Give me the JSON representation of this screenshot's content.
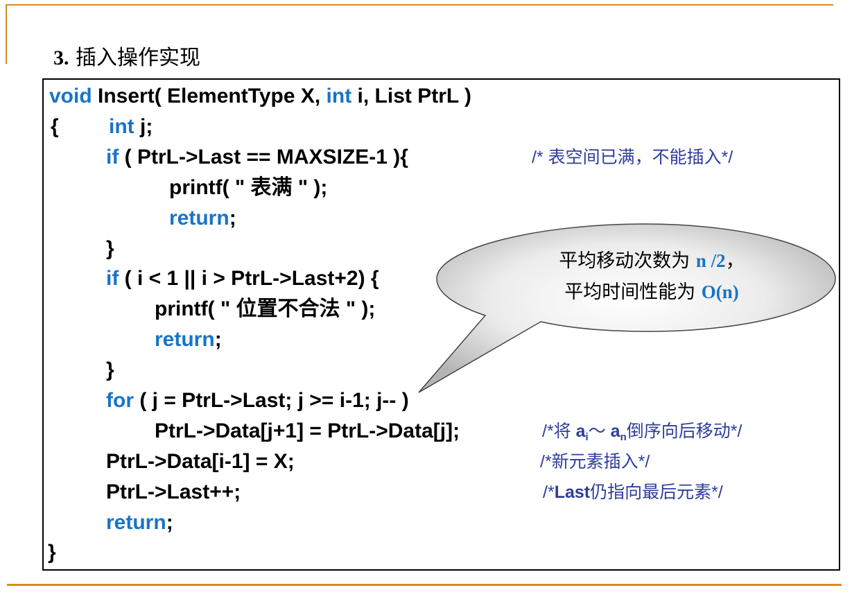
{
  "title": {
    "number": "3.",
    "text": "插入操作实现"
  },
  "code": {
    "l1": {
      "kw1": "void",
      "t1": " Insert( ElementType X, ",
      "kw2": "int",
      "t2": " i, List PtrL )"
    },
    "l2": {
      "t1": "{",
      "kw1": "int",
      "t2": " j;"
    },
    "l3": {
      "kw1": "if",
      "t1": " ( PtrL->Last == MAXSIZE-1 ){"
    },
    "l4": {
      "t1": "printf( \" 表满 \" );"
    },
    "l5": {
      "kw1": "return",
      "t1": ";"
    },
    "l6": {
      "t1": "}"
    },
    "l7": {
      "kw1": "if",
      "t1": " ( i < 1 || i > PtrL->Last+2) {"
    },
    "l8": {
      "t1": "printf( \" 位置不合法 \" );"
    },
    "l9": {
      "kw1": "return",
      "t1": ";"
    },
    "l10": {
      "t1": "}"
    },
    "l11": {
      "kw1": "for",
      "t1": " ( j = PtrL->Last; j >= i-1; j-- )"
    },
    "l12": {
      "t1": "PtrL->Data[j+1] = PtrL->Data[j];"
    },
    "l13": {
      "t1": "PtrL->Data[i-1] = X;"
    },
    "l14": {
      "t1": "PtrL->Last++;"
    },
    "l15": {
      "kw1": "return",
      "t1": ";"
    },
    "l16": {
      "t1": "}"
    }
  },
  "comments": {
    "c1": "/* 表空间已满，不能插入*/",
    "c2": {
      "pre": "/*将 ",
      "a1": "a",
      "s1": "i",
      "mid": "～ ",
      "a2": "a",
      "s2": "n",
      "post": "倒序向后移动*/"
    },
    "c3": "/*新元素插入*/",
    "c4": {
      "pre": "/*",
      "b": "Last",
      "post": "仍指向最后元素*/"
    }
  },
  "callout": {
    "line1_text": "平均移动次数为 ",
    "line1_value": "n /2",
    "line1_end": "，",
    "line2_text": "平均时间性能为 ",
    "line2_value": "O(n)"
  },
  "colors": {
    "keyword": "#1874c6",
    "comment": "#2e3d99",
    "rule": "#d98b1c"
  }
}
